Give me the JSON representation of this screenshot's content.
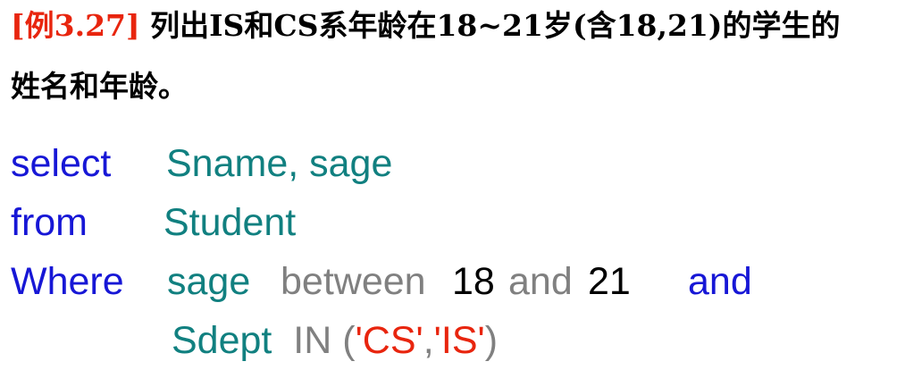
{
  "slide": {
    "example_label": "[例3.27]",
    "question_line1": " 列出IS和CS系年龄在18~21岁(含18,21)的学生的",
    "question_line2": "姓名和年龄。"
  },
  "code": {
    "select_kw": "select",
    "select_cols": "Sname, sage",
    "from_kw": "from",
    "from_table": "Student",
    "where_kw": "Where",
    "where_col": "sage",
    "between_kw": "between",
    "low_value": "18",
    "and_kw1": "and",
    "high_value": "21",
    "and_kw2": "and",
    "dept_col": "Sdept",
    "in_kw": "IN (",
    "str_cs": "'CS'",
    "comma": ",",
    "str_is": "'IS'",
    "close_paren": ")"
  },
  "colors": {
    "keyword": "#1717d6",
    "identifier": "#118080",
    "operator": "#808080",
    "string": "#e8250e",
    "example_label": "#e8250e"
  }
}
